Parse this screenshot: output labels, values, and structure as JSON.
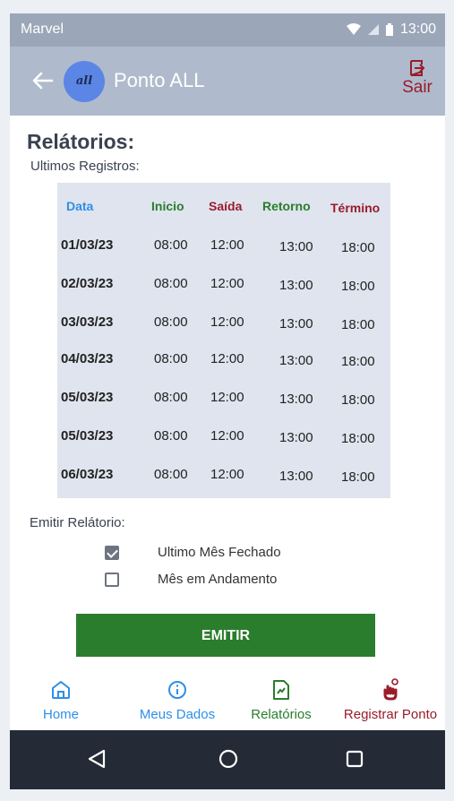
{
  "status": {
    "carrier": "Marvel",
    "time": "13:00"
  },
  "appbar": {
    "title": "Ponto ALL",
    "logo_text": "all",
    "logout_label": "Sair"
  },
  "page": {
    "title": "Relátorios:",
    "subtitle": "Ultimos Registros:"
  },
  "table": {
    "headers": [
      "Data",
      "Inicio",
      "Saída",
      "Retorno",
      "Término"
    ],
    "header_colors": [
      "#2e8fe8",
      "#2a7d2c",
      "#9a1b2a",
      "#2a7d2c",
      "#9a1b2a"
    ],
    "rows": [
      [
        "01/03/23",
        "08:00",
        "12:00",
        "13:00",
        "18:00"
      ],
      [
        "02/03/23",
        "08:00",
        "12:00",
        "13:00",
        "18:00"
      ],
      [
        "03/03/23",
        "08:00",
        "12:00",
        "13:00",
        "18:00"
      ],
      [
        "04/03/23",
        "08:00",
        "12:00",
        "13:00",
        "18:00"
      ],
      [
        "05/03/23",
        "08:00",
        "12:00",
        "13:00",
        "18:00"
      ],
      [
        "05/03/23",
        "08:00",
        "12:00",
        "13:00",
        "18:00"
      ],
      [
        "06/03/23",
        "08:00",
        "12:00",
        "13:00",
        "18:00"
      ]
    ]
  },
  "report": {
    "label": "Emitir Relátorio:",
    "options": [
      {
        "label": "Ultimo Mês Fechado",
        "checked": true
      },
      {
        "label": "Mês em Andamento",
        "checked": false
      }
    ],
    "emit_label": "EMITIR"
  },
  "nav": [
    {
      "label": "Home",
      "icon": "home-icon",
      "color": "#2e8fe8"
    },
    {
      "label": "Meus Dados",
      "icon": "info-icon",
      "color": "#2e8fe8"
    },
    {
      "label": "Relatórios",
      "icon": "report-icon",
      "color": "#2a7d2c"
    },
    {
      "label": "Registrar Ponto",
      "icon": "hand-touch-icon",
      "color": "#9a1b2a"
    }
  ],
  "colors": {
    "accent_blue": "#2e8fe8",
    "accent_green": "#2a7d2c",
    "accent_red": "#9a1b2a"
  }
}
